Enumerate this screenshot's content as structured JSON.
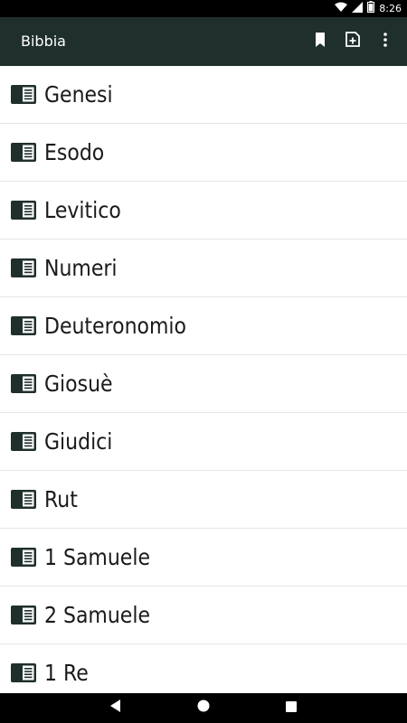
{
  "status_bar": {
    "time": "8:26",
    "icons": [
      "wifi-icon",
      "signal-icon",
      "battery-icon"
    ]
  },
  "app_bar": {
    "title": "Bibbia",
    "actions": [
      "bookmark-icon",
      "add-note-icon",
      "more-vert-icon"
    ]
  },
  "books": [
    {
      "label": "Genesi"
    },
    {
      "label": "Esodo"
    },
    {
      "label": "Levitico"
    },
    {
      "label": "Numeri"
    },
    {
      "label": "Deuteronomio"
    },
    {
      "label": "Giosuè"
    },
    {
      "label": "Giudici"
    },
    {
      "label": "Rut"
    },
    {
      "label": "1 Samuele"
    },
    {
      "label": "2 Samuele"
    },
    {
      "label": "1 Re"
    }
  ],
  "nav_bar": {
    "buttons": [
      "back-icon",
      "home-icon",
      "recents-icon"
    ]
  },
  "colors": {
    "app_bar": "#1f2f2c",
    "book_icon": "#1f2f2c",
    "text": "#1a1a1a"
  }
}
